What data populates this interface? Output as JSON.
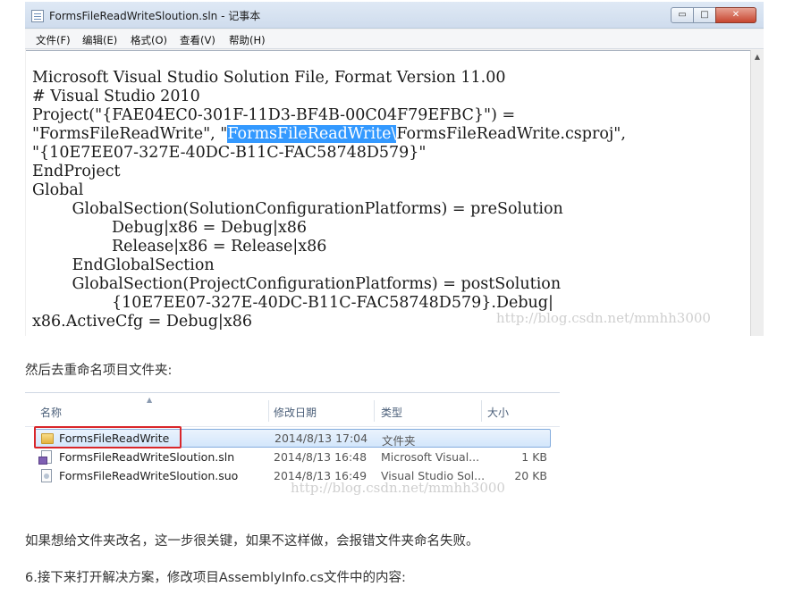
{
  "notepad": {
    "title": "FormsFileReadWriteSloution.sln - 记事本",
    "window_buttons": {
      "minimize": "▭",
      "maximize": "□",
      "close": "✕"
    },
    "menu": [
      "文件(F)",
      "编辑(E)",
      "格式(O)",
      "查看(V)",
      "帮助(H)"
    ],
    "lines": {
      "l1": "Microsoft Visual Studio Solution File, Format Version 11.00",
      "l2": "# Visual Studio 2010",
      "l3": "Project(\"{FAE04EC0-301F-11D3-BF4B-00C04F79EFBC}\") =",
      "l4_before": "\"FormsFileReadWrite\", \"",
      "l4_selected": "FormsFileReadWrite\\",
      "l4_after": "FormsFileReadWrite.csproj\",",
      "l5": "\"{10E7EE07-327E-40DC-B11C-FAC58748D579}\"",
      "l6": "EndProject",
      "l7": "Global",
      "l8": "        GlobalSection(SolutionConfigurationPlatforms) = preSolution",
      "l9": "                Debug|x86 = Debug|x86",
      "l10": "                Release|x86 = Release|x86",
      "l11": "        EndGlobalSection",
      "l12": "        GlobalSection(ProjectConfigurationPlatforms) = postSolution",
      "l13": "                {10E7EE07-327E-40DC-B11C-FAC58748D579}.Debug|",
      "l14": "x86.ActiveCfg = Debug|x86"
    },
    "watermark": "http://blog.csdn.net/mmhh3000"
  },
  "text": {
    "p1": "然后去重命名项目文件夹:",
    "p2": "如果想给文件夹改名，这一步很关键，如果不这样做，会报错文件夹命名失败。",
    "p3": "6.接下来打开解决方案，修改项目AssemblyInfo.cs文件中的内容:"
  },
  "explorer": {
    "columns": [
      "名称",
      "修改日期",
      "类型",
      "大小"
    ],
    "rows": [
      {
        "name": "FormsFileReadWrite",
        "date": "2014/8/13 17:04",
        "type": "文件夹",
        "size": "",
        "icon": "folder-icon"
      },
      {
        "name": "FormsFileReadWriteSloution.sln",
        "date": "2014/8/13 16:48",
        "type": "Microsoft Visual...",
        "size": "1 KB",
        "icon": "sln-file-icon"
      },
      {
        "name": "FormsFileReadWriteSloution.suo",
        "date": "2014/8/13 16:49",
        "type": "Visual Studio Sol...",
        "size": "20 KB",
        "icon": "suo-file-icon"
      }
    ],
    "watermark": "http://blog.csdn.net/mmhh3000"
  },
  "colors": {
    "selection": "#3399ff",
    "highlight_box": "#d9262a",
    "close_button": "#c7452f"
  }
}
